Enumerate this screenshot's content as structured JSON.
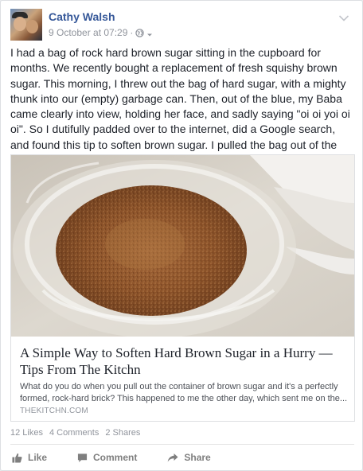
{
  "post": {
    "author": "Cathy Walsh",
    "date": "9 October at 07:29",
    "separator": "·",
    "privacy_icon": "globe-icon",
    "menu_icon": "chevron-down-icon",
    "text": "I had a bag of rock hard brown sugar sitting in the cupboard for months. We recently bought a replacement of fresh squishy brown sugar. This morning, I threw out the bag of hard sugar, with a mighty thunk into our (empty) garbage can. Then, out of the blue, my Baba came clearly into view, holding her face, and sadly saying \"oi oi yoi oi oi\". So I dutifully padded over to the internet, did a Google search, and found this tip to soften brown sugar. I pulled the bag out of the garbage, and did what this instructs. It worked like a charm!"
  },
  "link": {
    "title": "A Simple Way to Soften Hard Brown Sugar in a Hurry — Tips From The Kitchn",
    "description": "What do you do when you pull out the container of brown sugar and it's a perfectly formed, rock-hard brick? This happened to me the other day, which sent me on the...",
    "domain": "THEKITCHN.COM"
  },
  "stats": {
    "likes": "12 Likes",
    "comments": "4 Comments",
    "shares": "2 Shares"
  },
  "actions": {
    "like": "Like",
    "comment": "Comment",
    "share": "Share"
  },
  "colors": {
    "author_link": "#365899",
    "meta_gray": "#90949c",
    "action_gray": "#7f7f7f"
  }
}
